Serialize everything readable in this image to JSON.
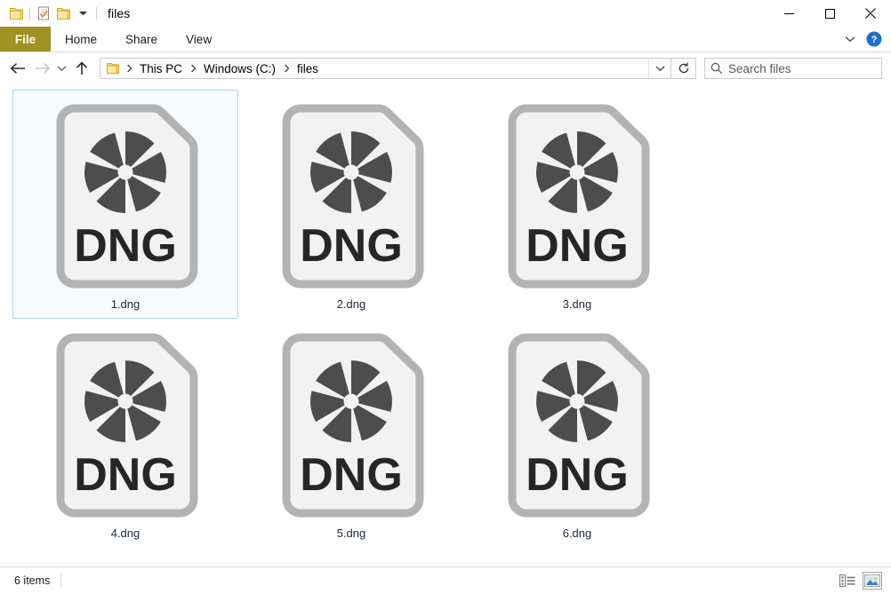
{
  "window": {
    "title": "files",
    "quick_access": [
      {
        "name": "folder-icon",
        "label": "Folder"
      },
      {
        "name": "properties-icon",
        "label": "Properties"
      },
      {
        "name": "new-folder-icon",
        "label": "New folder"
      },
      {
        "name": "chevron-down-icon",
        "label": "Customize Quick Access Toolbar"
      }
    ],
    "caption": {
      "minimize": "Minimize",
      "maximize": "Maximize",
      "close": "Close"
    }
  },
  "ribbon": {
    "tabs": [
      {
        "label": "File",
        "active_style": "file"
      },
      {
        "label": "Home"
      },
      {
        "label": "Share"
      },
      {
        "label": "View"
      }
    ],
    "expand_label": "Expand the Ribbon",
    "help_label": "Help",
    "file_tab_color": "#9f9122"
  },
  "address": {
    "back_label": "Back",
    "forward_label": "Forward",
    "recent_label": "Recent locations",
    "up_label": "Up",
    "breadcrumb": [
      "This PC",
      "Windows (C:)",
      "files"
    ],
    "dropdown_label": "Previous locations",
    "refresh_label": "Refresh",
    "search": {
      "placeholder": "Search files",
      "value": ""
    }
  },
  "files": [
    {
      "name": "1.dng",
      "type": "DNG",
      "selected": true
    },
    {
      "name": "2.dng",
      "type": "DNG",
      "selected": false
    },
    {
      "name": "3.dng",
      "type": "DNG",
      "selected": false
    },
    {
      "name": "4.dng",
      "type": "DNG",
      "selected": false
    },
    {
      "name": "5.dng",
      "type": "DNG",
      "selected": false
    },
    {
      "name": "6.dng",
      "type": "DNG",
      "selected": false
    }
  ],
  "status": {
    "item_count": "6 items",
    "details_view_label": "Details view",
    "large_icons_view_label": "Large icons view",
    "active_view": "large-icons"
  },
  "colors": {
    "selection_border": "#a8d5f2",
    "selection_fill": "#f7fbfe",
    "file_tab": "#9f9122",
    "icon_outline": "#b3b3b3",
    "icon_fill": "#f2f2f2",
    "aperture": "#4d4d4d",
    "label_text": "#1b2838",
    "help_blue": "#1f6fc4"
  }
}
